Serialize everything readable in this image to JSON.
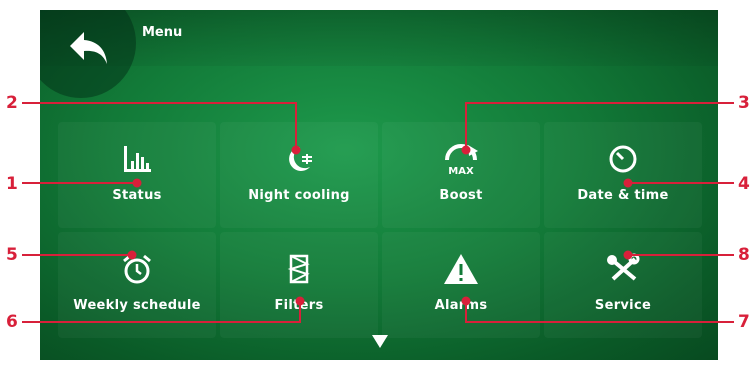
{
  "header": {
    "title": "Menu"
  },
  "tiles": [
    {
      "label": "Status",
      "icon": "bar-chart-icon"
    },
    {
      "label": "Night cooling",
      "icon": "moon-fan-icon"
    },
    {
      "label": "Boost",
      "icon": "boost-gauge-icon",
      "icon_text": "MAX"
    },
    {
      "label": "Date & time",
      "icon": "clock-icon"
    },
    {
      "label": "Weekly schedule",
      "icon": "alarm-clock-icon"
    },
    {
      "label": "Filters",
      "icon": "filter-icon"
    },
    {
      "label": "Alarms",
      "icon": "warning-icon"
    },
    {
      "label": "Service",
      "icon": "tools-icon"
    }
  ],
  "callouts": [
    "1",
    "2",
    "3",
    "4",
    "5",
    "6",
    "7",
    "8"
  ],
  "colors": {
    "accent": "#d8203a",
    "background": "#127a38",
    "text": "#ffffff"
  }
}
